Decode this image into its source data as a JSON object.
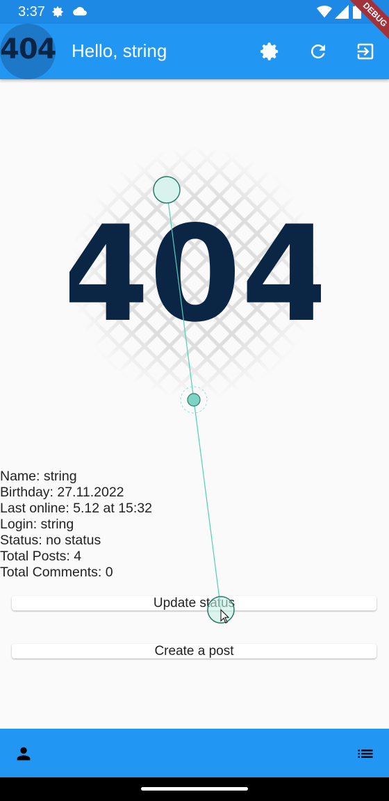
{
  "status_bar": {
    "time": "3:37"
  },
  "app_bar": {
    "avatar_text": "404",
    "title": "Hello, string",
    "debug_label": "DEBUG"
  },
  "hero_image": {
    "text": "404"
  },
  "profile": {
    "name": "Name: string",
    "birthday": "Birthday: 27.11.2022",
    "last_online": "Last online: 5.12 at 15:32",
    "login": "Login: string",
    "status": "Status: no status",
    "total_posts": "Total Posts: 4",
    "total_comments": "Total Comments: 0"
  },
  "buttons": {
    "update_status": "Update status",
    "create_post": "Create a post"
  },
  "colors": {
    "primary": "#2196f3",
    "status_bar": "#1e88e5",
    "logo_dark": "#0b2545"
  }
}
